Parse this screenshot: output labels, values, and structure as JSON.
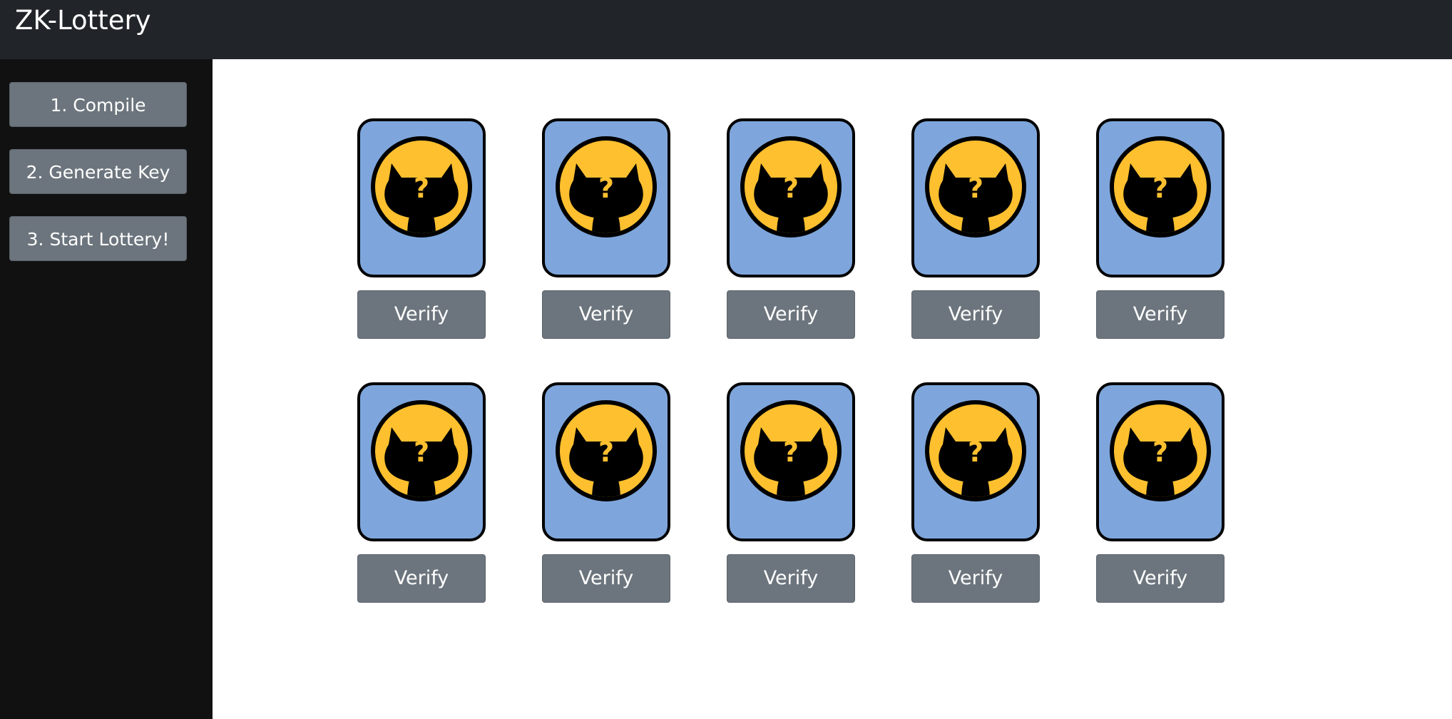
{
  "header": {
    "title": "ZK-Lottery"
  },
  "sidebar": {
    "buttons": [
      {
        "label": "1. Compile"
      },
      {
        "label": "2. Generate Key"
      },
      {
        "label": "3. Start Lottery!"
      }
    ]
  },
  "grid": {
    "cards": [
      {
        "icon": "github-octocat-question-icon",
        "mark": "?",
        "verify_label": "Verify"
      },
      {
        "icon": "github-octocat-question-icon",
        "mark": "?",
        "verify_label": "Verify"
      },
      {
        "icon": "github-octocat-question-icon",
        "mark": "?",
        "verify_label": "Verify"
      },
      {
        "icon": "github-octocat-question-icon",
        "mark": "?",
        "verify_label": "Verify"
      },
      {
        "icon": "github-octocat-question-icon",
        "mark": "?",
        "verify_label": "Verify"
      },
      {
        "icon": "github-octocat-question-icon",
        "mark": "?",
        "verify_label": "Verify"
      },
      {
        "icon": "github-octocat-question-icon",
        "mark": "?",
        "verify_label": "Verify"
      },
      {
        "icon": "github-octocat-question-icon",
        "mark": "?",
        "verify_label": "Verify"
      },
      {
        "icon": "github-octocat-question-icon",
        "mark": "?",
        "verify_label": "Verify"
      },
      {
        "icon": "github-octocat-question-icon",
        "mark": "?",
        "verify_label": "Verify"
      }
    ]
  },
  "colors": {
    "header_bg": "#212529",
    "sidebar_bg": "#111111",
    "button_bg": "#6c757d",
    "card_bg": "#7ea6dc",
    "coin_yellow": "#fec02f"
  }
}
